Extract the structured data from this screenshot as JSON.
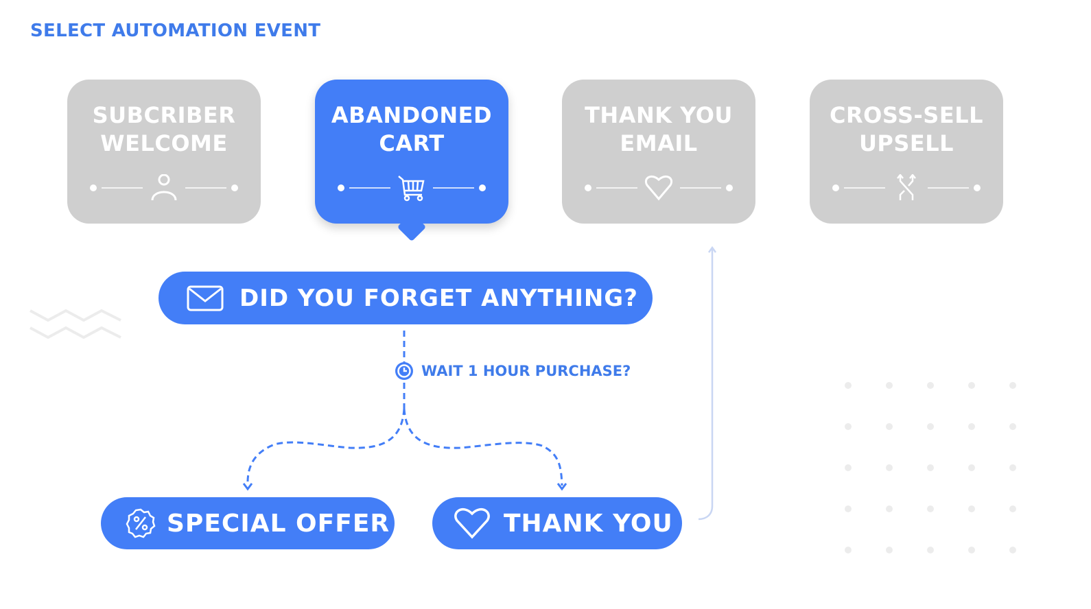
{
  "header": {
    "title": "SELECT AUTOMATION EVENT"
  },
  "colors": {
    "accent": "#437ef7",
    "inactive": "#cfcfcf",
    "text_accent": "#3f7bea",
    "return_line": "#c9d6f3"
  },
  "events": [
    {
      "label": "SUBCRIBER\nWELCOME",
      "icon": "user-icon",
      "selected": false
    },
    {
      "label": "ABANDONED\nCART",
      "icon": "cart-icon",
      "selected": true
    },
    {
      "label": "THANK YOU\nEMAIL",
      "icon": "heart-icon",
      "selected": false
    },
    {
      "label": "CROSS-SELL\nUPSELL",
      "icon": "shuffle-icon",
      "selected": false
    }
  ],
  "flow": {
    "email_step": {
      "label": "DID YOU FORGET ANYTHING?",
      "icon": "mail-icon"
    },
    "wait_step": {
      "label": "WAIT 1 HOUR PURCHASE?",
      "icon": "clock-icon"
    },
    "branches": [
      {
        "label": "SPECIAL OFFER",
        "icon": "discount-badge-icon"
      },
      {
        "label": "THANK YOU",
        "icon": "heart-icon"
      }
    ]
  }
}
